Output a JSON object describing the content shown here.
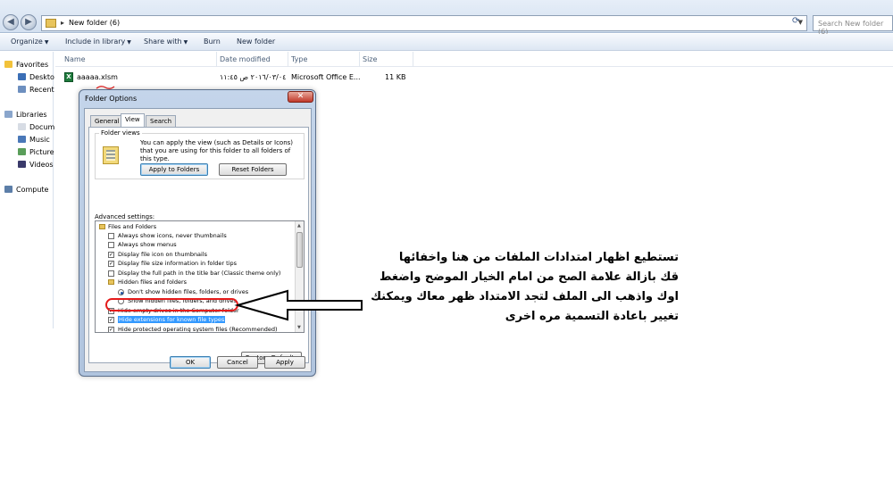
{
  "window": {
    "address": "New folder (6)",
    "search_placeholder": "Search New folder (6)"
  },
  "toolbar": {
    "organize": "Organize",
    "include": "Include in library",
    "share": "Share with",
    "burn": "Burn",
    "new_folder": "New folder"
  },
  "sidebar": {
    "favorites": "Favorites",
    "desktop": "Deskto",
    "recent": "Recent",
    "libraries": "Libraries",
    "documents": "Docum",
    "music": "Music",
    "pictures": "Picture",
    "videos": "Videos",
    "computer": "Compute"
  },
  "columns": {
    "name": "Name",
    "date": "Date modified",
    "type": "Type",
    "size": "Size"
  },
  "file": {
    "name": "aaaaa.xlsm",
    "date": "٢٠١٦/٠٣/٠٤ ص ١١:٤٥",
    "type": "Microsoft Office E...",
    "size": "11 KB"
  },
  "dialog": {
    "title": "Folder Options",
    "tabs": [
      "General",
      "View",
      "Search"
    ],
    "folder_views_legend": "Folder views",
    "folder_views_desc": "You can apply the view (such as Details or Icons) that you are using for this folder to all folders of this type.",
    "apply_to_folders": "Apply to Folders",
    "reset_folders": "Reset Folders",
    "advanced_label": "Advanced settings:",
    "advanced_items": [
      {
        "kind": "folder",
        "label": "Files and Folders"
      },
      {
        "kind": "check",
        "checked": false,
        "label": "Always show icons, never thumbnails"
      },
      {
        "kind": "check",
        "checked": false,
        "label": "Always show menus"
      },
      {
        "kind": "check",
        "checked": true,
        "label": "Display file icon on thumbnails"
      },
      {
        "kind": "check",
        "checked": true,
        "label": "Display file size information in folder tips"
      },
      {
        "kind": "check",
        "checked": false,
        "label": "Display the full path in the title bar (Classic theme only)"
      },
      {
        "kind": "folder",
        "label": "Hidden files and folders"
      },
      {
        "kind": "radio",
        "checked": true,
        "label": "Don't show hidden files, folders, or drives"
      },
      {
        "kind": "radio",
        "checked": false,
        "label": "Show hidden files, folders, and drives"
      },
      {
        "kind": "check",
        "checked": true,
        "label": "Hide empty drives in the Computer folder"
      },
      {
        "kind": "check",
        "checked": true,
        "label": "Hide extensions for known file types",
        "highlighted": true
      },
      {
        "kind": "check",
        "checked": true,
        "label": "Hide protected operating system files (Recommended)"
      }
    ],
    "restore_defaults": "Restore Defaults",
    "ok": "OK",
    "cancel": "Cancel",
    "apply": "Apply"
  },
  "annotation": {
    "lines": [
      "تستطيع اظهار امتدادات الملفات من هنا واخفائها",
      "قك بازالة علامة الصح من امام الخيار الموضح واضغط",
      "اوك واذهب الى الملف لتجد الامتداد ظهر معاك  ويمكنك",
      "تغيير باعادة التسمية مره اخرى"
    ]
  },
  "colors": {
    "highlight": "#3399ff",
    "annotation_red": "#e51b1b"
  }
}
